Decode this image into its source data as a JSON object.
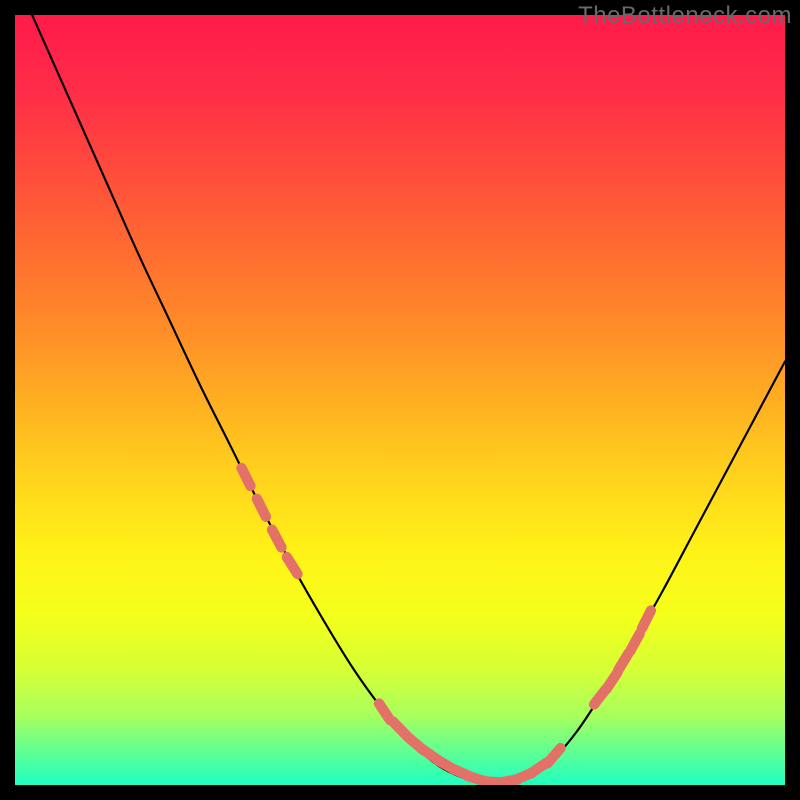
{
  "watermark": "TheBottleneck.com",
  "colors": {
    "background": "#000000",
    "watermark": "#666a6c",
    "curve": "#000000",
    "marker_fill": "#e37168",
    "marker_stroke": "#c9574f",
    "gradient_stops": [
      {
        "offset": 0.0,
        "color": "#ff1b4b"
      },
      {
        "offset": 0.1,
        "color": "#ff2d48"
      },
      {
        "offset": 0.2,
        "color": "#ff4b3c"
      },
      {
        "offset": 0.3,
        "color": "#ff6a31"
      },
      {
        "offset": 0.4,
        "color": "#ff8a29"
      },
      {
        "offset": 0.5,
        "color": "#ffae22"
      },
      {
        "offset": 0.6,
        "color": "#ffd31c"
      },
      {
        "offset": 0.7,
        "color": "#fff318"
      },
      {
        "offset": 0.78,
        "color": "#f4ff1b"
      },
      {
        "offset": 0.85,
        "color": "#d6ff35"
      },
      {
        "offset": 0.91,
        "color": "#a8ff5e"
      },
      {
        "offset": 0.96,
        "color": "#5bff97"
      },
      {
        "offset": 1.0,
        "color": "#1effc1"
      }
    ]
  },
  "chart_data": {
    "type": "line",
    "title": "",
    "xlabel": "",
    "ylabel": "",
    "xlim": [
      0,
      100
    ],
    "ylim": [
      0,
      100
    ],
    "grid": false,
    "legend": false,
    "series": [
      {
        "name": "bottleneck-curve",
        "x": [
          0,
          4,
          8,
          12,
          16,
          20,
          24,
          28,
          32,
          36,
          40,
          44,
          48,
          52,
          55,
          58,
          61,
          64,
          67,
          70,
          73,
          76,
          80,
          84,
          88,
          92,
          96,
          100
        ],
        "y": [
          105,
          96,
          87,
          78,
          69,
          60.5,
          52,
          44,
          36,
          28.5,
          21.5,
          15,
          9.5,
          5,
          2.5,
          1,
          0.3,
          0.5,
          1.5,
          3.5,
          7,
          11.5,
          18,
          25,
          32.5,
          40,
          47.5,
          55
        ]
      }
    ],
    "markers": {
      "name": "highlighted-points",
      "x": [
        30,
        32,
        34,
        36,
        48,
        50,
        52,
        54,
        56,
        58,
        60,
        62,
        64,
        66,
        68,
        70,
        76,
        77.5,
        79,
        80.5,
        82
      ],
      "y": [
        40,
        36,
        32,
        28.5,
        9.5,
        7.3,
        5.4,
        3.9,
        2.6,
        1.6,
        0.8,
        0.4,
        0.5,
        1.1,
        2.2,
        3.8,
        11.5,
        13.5,
        16,
        18.5,
        21.5
      ]
    }
  }
}
